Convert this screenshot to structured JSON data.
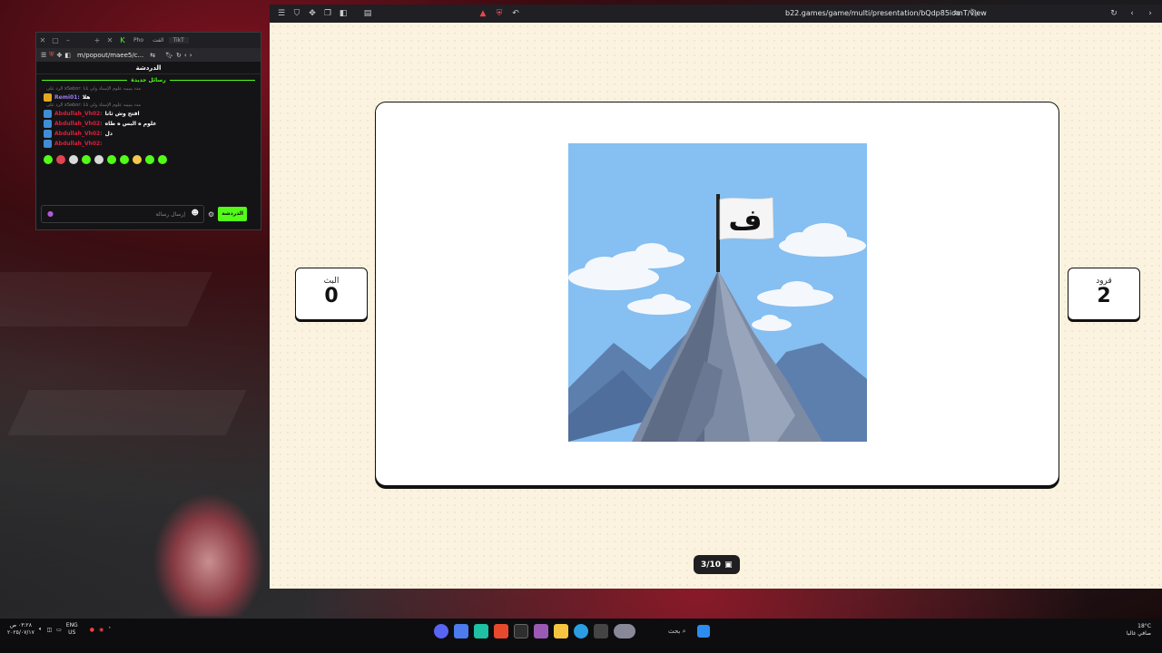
{
  "main_browser": {
    "url": "b22.games/game/multi/presentation/bQdp85iomT/view"
  },
  "game": {
    "left_team": {
      "label": "البث",
      "score": "0"
    },
    "right_team": {
      "label": "قرود",
      "score": "2"
    },
    "flag_letter": "ف",
    "progress": "3/10"
  },
  "popout": {
    "tabs": [
      "Pho",
      "الفت",
      "TikT"
    ],
    "url": "m/popout/maee5/c...",
    "title": "الدردشة",
    "new_messages": "رسائل جديدة",
    "messages": [
      {
        "reply": "الرد على xSabor: مدد بيبيبه علوم الإستاذ ولي ثانا",
        "user": "Remi01:",
        "text": "هلا",
        "badge": "crown",
        "user_color": "green"
      },
      {
        "reply": "الرد على xSabor: مدد بيبيبه علوم الإستاذ ولي ثانا",
        "user": "Abdullah_Vh02:",
        "text": "افتح وش ثانا",
        "badge": "kick",
        "user_color": "red"
      },
      {
        "reply": "",
        "user": "Abdullah_Vh02:",
        "text": "علوم ه البس ه طاه",
        "badge": "kick",
        "user_color": "red"
      },
      {
        "reply": "",
        "user": "Abdullah_Vh02:",
        "text": "دل",
        "badge": "kick",
        "user_color": "red"
      },
      {
        "reply": "",
        "user": "Abdullah_Vh02:",
        "text": "",
        "badge": "kick",
        "user_color": "red"
      }
    ],
    "input_placeholder": "إرسال رسالة",
    "send_label": "الدردشة"
  },
  "taskbar": {
    "search_label": "بحث",
    "lang": "ENG",
    "lang_region": "US",
    "clock_time": "٠٣:٢٨ ص",
    "clock_date": "٢٠٢٥/٠٧/١٧",
    "weather_temp": "18°C",
    "weather_desc": "صافي غالبا"
  },
  "colors": {
    "game_bg": "#fbf3df",
    "kick_green": "#53fc18",
    "sky": "#86bff1"
  }
}
